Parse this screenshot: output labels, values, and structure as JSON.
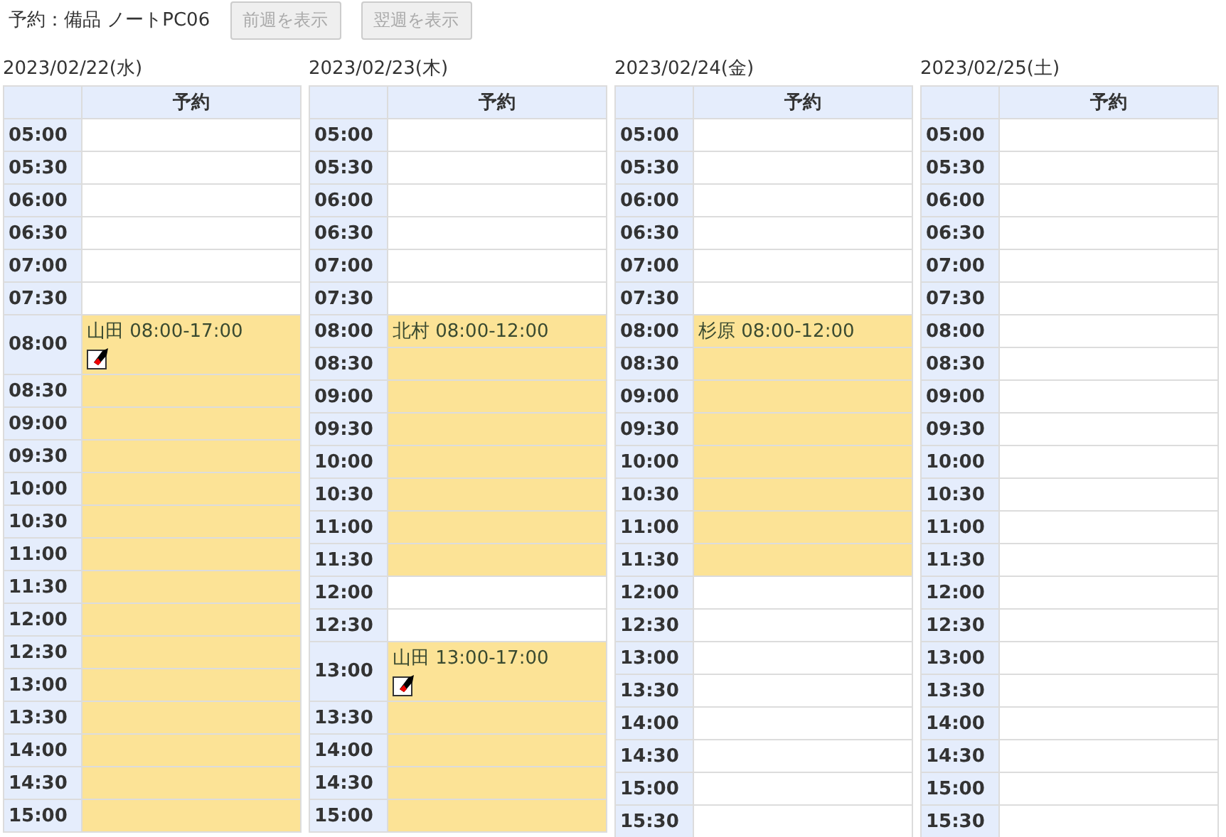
{
  "title": "予約：備品 ノートPC06",
  "buttons": [
    {
      "label": "前週を表示",
      "disabled": true
    },
    {
      "label": "翌週を表示",
      "disabled": true
    }
  ],
  "days": [
    {
      "date": "2023/02/22(水)",
      "header": "予約",
      "rows": [
        {
          "time": "05:00",
          "booked": false
        },
        {
          "time": "05:30",
          "booked": false
        },
        {
          "time": "06:00",
          "booked": false
        },
        {
          "time": "06:30",
          "booked": false
        },
        {
          "time": "07:00",
          "booked": false
        },
        {
          "time": "07:30",
          "booked": false
        },
        {
          "time": "08:00",
          "booked": true,
          "text": "山田 08:00-17:00",
          "edit": true
        },
        {
          "time": "08:30",
          "booked": true
        },
        {
          "time": "09:00",
          "booked": true
        },
        {
          "time": "09:30",
          "booked": true
        },
        {
          "time": "10:00",
          "booked": true
        },
        {
          "time": "10:30",
          "booked": true
        },
        {
          "time": "11:00",
          "booked": true
        },
        {
          "time": "11:30",
          "booked": true
        },
        {
          "time": "12:00",
          "booked": true
        },
        {
          "time": "12:30",
          "booked": true
        },
        {
          "time": "13:00",
          "booked": true
        },
        {
          "time": "13:30",
          "booked": true
        },
        {
          "time": "14:00",
          "booked": true
        },
        {
          "time": "14:30",
          "booked": true
        },
        {
          "time": "15:00",
          "booked": true
        }
      ]
    },
    {
      "date": "2023/02/23(木)",
      "header": "予約",
      "rows": [
        {
          "time": "05:00",
          "booked": false
        },
        {
          "time": "05:30",
          "booked": false
        },
        {
          "time": "06:00",
          "booked": false
        },
        {
          "time": "06:30",
          "booked": false
        },
        {
          "time": "07:00",
          "booked": false
        },
        {
          "time": "07:30",
          "booked": false
        },
        {
          "time": "08:00",
          "booked": true,
          "text": "北村 08:00-12:00"
        },
        {
          "time": "08:30",
          "booked": true
        },
        {
          "time": "09:00",
          "booked": true
        },
        {
          "time": "09:30",
          "booked": true
        },
        {
          "time": "10:00",
          "booked": true
        },
        {
          "time": "10:30",
          "booked": true
        },
        {
          "time": "11:00",
          "booked": true
        },
        {
          "time": "11:30",
          "booked": true
        },
        {
          "time": "12:00",
          "booked": false
        },
        {
          "time": "12:30",
          "booked": false
        },
        {
          "time": "13:00",
          "booked": true,
          "text": "山田 13:00-17:00",
          "edit": true
        },
        {
          "time": "13:30",
          "booked": true
        },
        {
          "time": "14:00",
          "booked": true
        },
        {
          "time": "14:30",
          "booked": true
        },
        {
          "time": "15:00",
          "booked": true
        }
      ]
    },
    {
      "date": "2023/02/24(金)",
      "header": "予約",
      "rows": [
        {
          "time": "05:00",
          "booked": false
        },
        {
          "time": "05:30",
          "booked": false
        },
        {
          "time": "06:00",
          "booked": false
        },
        {
          "time": "06:30",
          "booked": false
        },
        {
          "time": "07:00",
          "booked": false
        },
        {
          "time": "07:30",
          "booked": false
        },
        {
          "time": "08:00",
          "booked": true,
          "text": "杉原 08:00-12:00"
        },
        {
          "time": "08:30",
          "booked": true
        },
        {
          "time": "09:00",
          "booked": true
        },
        {
          "time": "09:30",
          "booked": true
        },
        {
          "time": "10:00",
          "booked": true
        },
        {
          "time": "10:30",
          "booked": true
        },
        {
          "time": "11:00",
          "booked": true
        },
        {
          "time": "11:30",
          "booked": true
        },
        {
          "time": "12:00",
          "booked": false
        },
        {
          "time": "12:30",
          "booked": false
        },
        {
          "time": "13:00",
          "booked": false
        },
        {
          "time": "13:30",
          "booked": false
        },
        {
          "time": "14:00",
          "booked": false
        },
        {
          "time": "14:30",
          "booked": false
        },
        {
          "time": "15:00",
          "booked": false
        },
        {
          "time": "15:30",
          "booked": false
        }
      ]
    },
    {
      "date": "2023/02/25(土)",
      "header": "予約",
      "rows": [
        {
          "time": "05:00",
          "booked": false
        },
        {
          "time": "05:30",
          "booked": false
        },
        {
          "time": "06:00",
          "booked": false
        },
        {
          "time": "06:30",
          "booked": false
        },
        {
          "time": "07:00",
          "booked": false
        },
        {
          "time": "07:30",
          "booked": false
        },
        {
          "time": "08:00",
          "booked": false
        },
        {
          "time": "08:30",
          "booked": false
        },
        {
          "time": "09:00",
          "booked": false
        },
        {
          "time": "09:30",
          "booked": false
        },
        {
          "time": "10:00",
          "booked": false
        },
        {
          "time": "10:30",
          "booked": false
        },
        {
          "time": "11:00",
          "booked": false
        },
        {
          "time": "11:30",
          "booked": false
        },
        {
          "time": "12:00",
          "booked": false
        },
        {
          "time": "12:30",
          "booked": false
        },
        {
          "time": "13:00",
          "booked": false
        },
        {
          "time": "13:30",
          "booked": false
        },
        {
          "time": "14:00",
          "booked": false
        },
        {
          "time": "14:30",
          "booked": false
        },
        {
          "time": "15:00",
          "booked": false
        },
        {
          "time": "15:30",
          "booked": false
        }
      ]
    }
  ]
}
